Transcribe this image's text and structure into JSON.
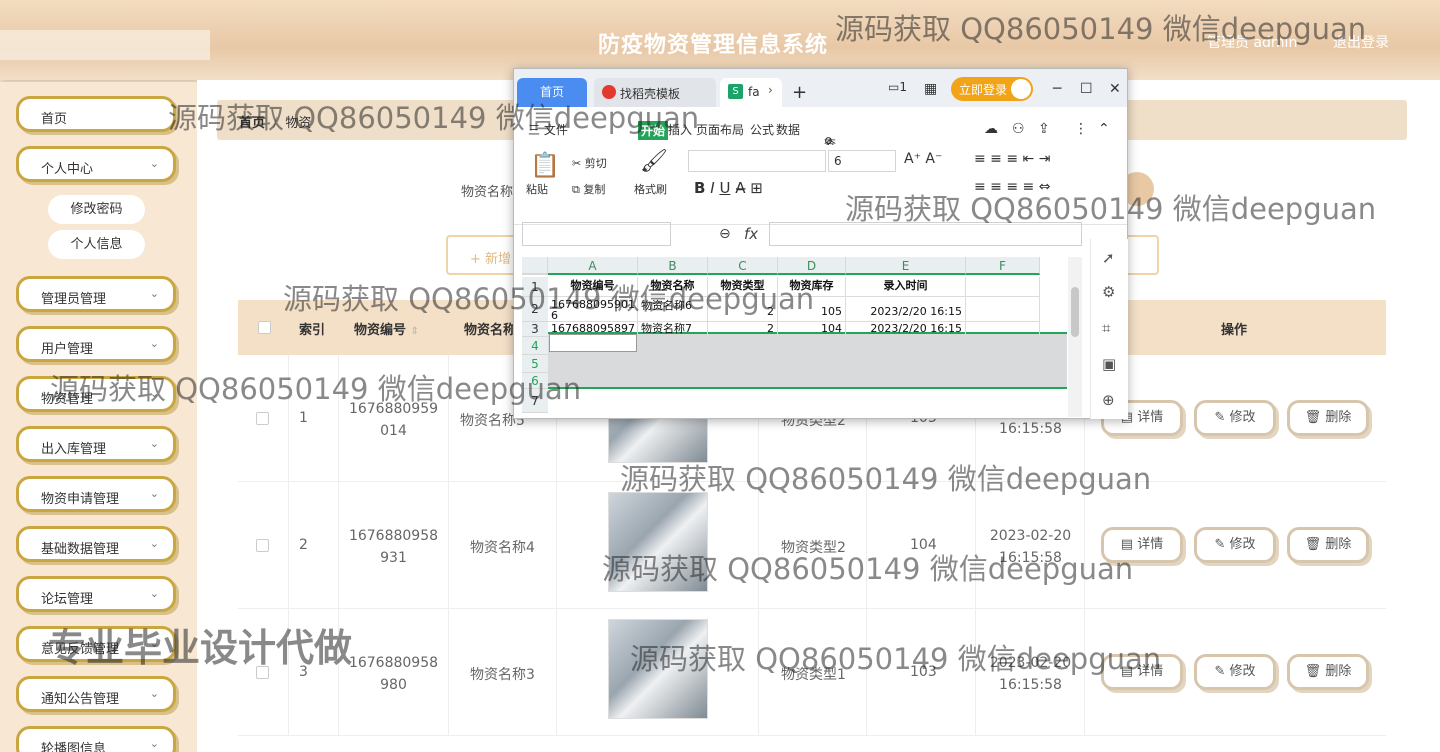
{
  "header": {
    "title": "防疫物资管理信息系统",
    "admin": "管理员 admin",
    "logout": "退出登录"
  },
  "sidebar": {
    "home": "首页",
    "personal": "个人中心",
    "change_password": "修改密码",
    "profile": "个人信息",
    "items": [
      "管理员管理",
      "用户管理",
      "物资管理",
      "出入库管理",
      "物资申请管理",
      "基础数据管理",
      "论坛管理",
      "意见反馈管理",
      "通知公告管理",
      "轮播图信息"
    ]
  },
  "breadcrumb": {
    "home": "首页",
    "current": "物资"
  },
  "search": {
    "label": "物资名称"
  },
  "toolbar": {
    "add_label": "+ 新增"
  },
  "table": {
    "headers": {
      "index": "索引",
      "code": "物资编号",
      "name": "物资名称",
      "action": "操作"
    },
    "rows": [
      {
        "index": "1",
        "code": "1676880959\n014",
        "name": "物资名称5",
        "type": "物资类型2",
        "stock": "103",
        "time": "16:15:58"
      },
      {
        "index": "2",
        "code": "1676880958\n931",
        "name": "物资名称4",
        "type": "物资类型2",
        "stock": "104",
        "time": "2023-02-20\n16:15:58"
      },
      {
        "index": "3",
        "code": "1676880958\n980",
        "name": "物资名称3",
        "type": "物资类型1",
        "stock": "103",
        "time": "2023-02-20\n16:15:58"
      }
    ],
    "actions": {
      "detail": "详情",
      "edit": "修改",
      "delete": "删除"
    }
  },
  "spreadsheet": {
    "tabs": {
      "home": "首页",
      "template": "找稻壳模板",
      "file": "fa"
    },
    "login": "立即登录",
    "menu": {
      "file": "三 文件",
      "start": "开始",
      "insert": "插入",
      "layout": "页面布局",
      "formula": "公式",
      "data": "数据",
      "search": "查找"
    },
    "ribbon": {
      "paste": "粘贴",
      "cut": "剪切",
      "copy": "复制",
      "format_painter": "格式刷",
      "font_size": "6"
    },
    "columns": [
      "A",
      "B",
      "C",
      "D",
      "E",
      "F"
    ],
    "row_numbers": [
      "1",
      "2",
      "3",
      "4",
      "5",
      "6",
      "7"
    ],
    "header_row": [
      "物资编号",
      "物资名称",
      "物资类型",
      "物资库存",
      "录入时间"
    ],
    "data_rows": [
      [
        "167688095901\n6",
        "物资名称6",
        "2",
        "105",
        "2023/2/20  16:15"
      ],
      [
        "167688095897",
        "物资名称7",
        "2",
        "104",
        "2023/2/20  16:15"
      ]
    ]
  },
  "watermark": {
    "text": "源码获取 QQ86050149 微信deepguan",
    "banner": "专业毕业设计代做"
  }
}
